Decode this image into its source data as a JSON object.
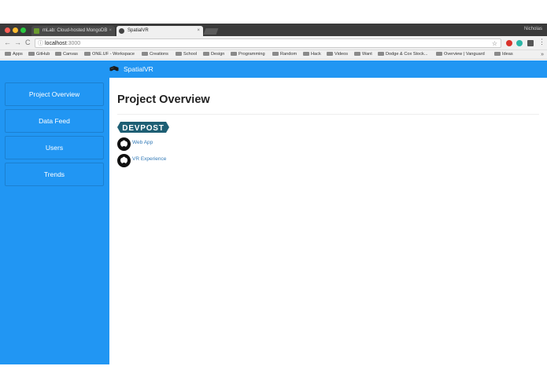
{
  "browser": {
    "tabs": [
      {
        "title": "mLab: Cloud-hosted MongoDB",
        "close": "×"
      },
      {
        "title": "SpatialVR",
        "close": "×"
      }
    ],
    "profile_name": "Nicholas",
    "nav": {
      "back": "←",
      "forward": "→",
      "reload": "C"
    },
    "url_host": "localhost",
    "url_port": ":3000",
    "bookmarks": [
      "Apps",
      "GitHub",
      "Canvas",
      "ONE.UF - Workspace",
      "Creations",
      "School",
      "Design",
      "Programming",
      "Random",
      "Hack",
      "Videos",
      "Want",
      "Dodge & Cox Stock...",
      "Overview | Vanguard",
      "Ideas"
    ],
    "bookmarks_more": "»"
  },
  "app": {
    "brand": "SpatialVR",
    "accent_color": "#2196f3",
    "sidebar": [
      {
        "label": "Project Overview"
      },
      {
        "label": "Data Feed"
      },
      {
        "label": "Users"
      },
      {
        "label": "Trends"
      }
    ],
    "main": {
      "title": "Project Overview",
      "devpost_label": "DEVPOST",
      "links": [
        {
          "label": "Web App",
          "icon": "github-icon"
        },
        {
          "label": "VR Experience",
          "icon": "github-icon"
        }
      ]
    }
  }
}
